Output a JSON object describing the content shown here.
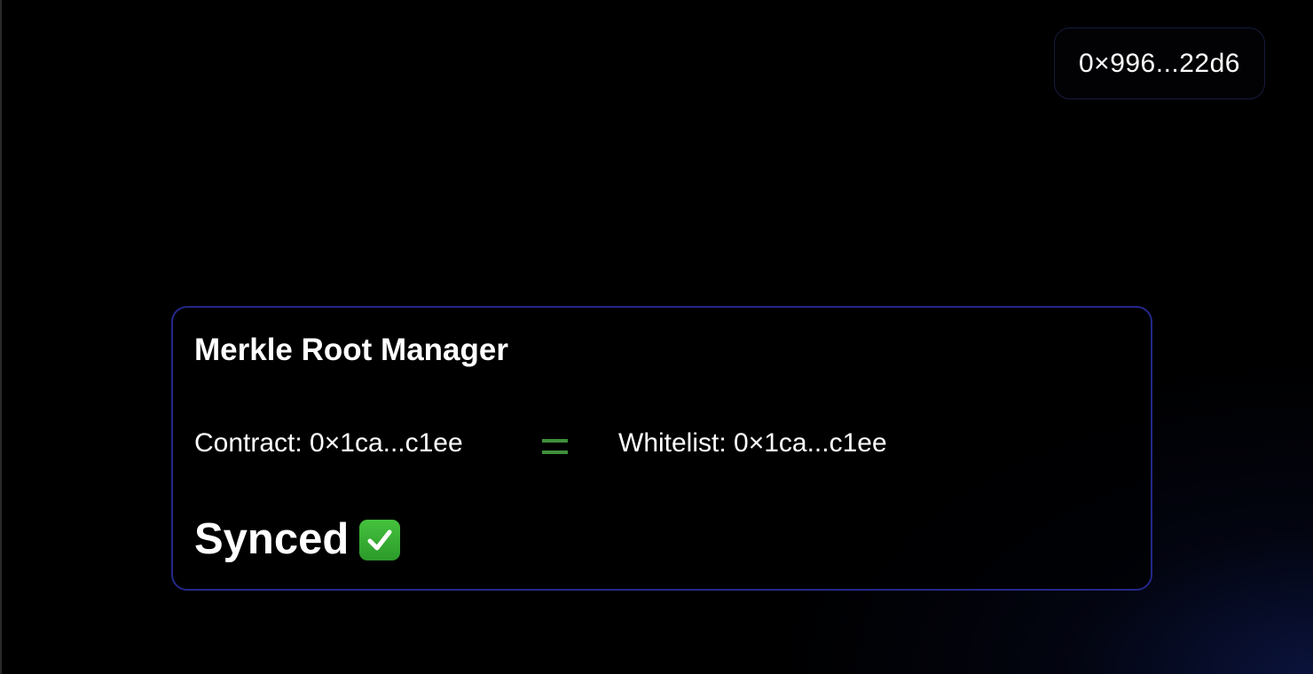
{
  "header": {
    "wallet_address": "0×996...22d6"
  },
  "merkle_card": {
    "title": "Merkle Root Manager",
    "contract_root": "Contract: 0×1ca...c1ee",
    "whitelist_root": "Whitelist: 0×1ca...c1ee",
    "comparison_icon": "equals-icon",
    "status_text": "Synced",
    "status_icon": "check-mark-icon"
  },
  "colors": {
    "background": "#000000",
    "card_border": "#23288a",
    "equals_green": "#3f8f3a",
    "check_green": "#3aaf36"
  }
}
